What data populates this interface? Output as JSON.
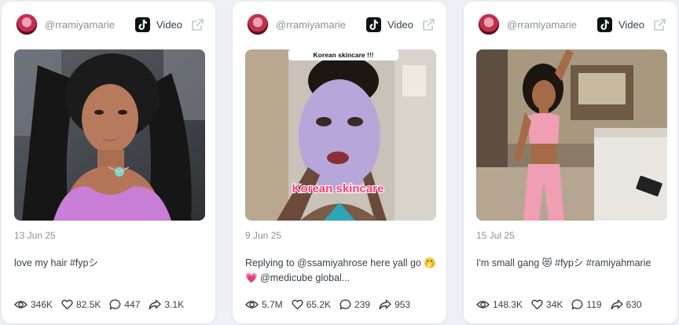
{
  "cards": [
    {
      "handle": "@rramiyamarie",
      "platform_label": "Video",
      "date": "13 Jun 25",
      "caption": "love my hair #fypシ",
      "stats": {
        "views": "346K",
        "likes": "82.5K",
        "comments": "447",
        "shares": "3.1K"
      }
    },
    {
      "handle": "@rramiyamarie",
      "platform_label": "Video",
      "date": "9 Jun 25",
      "caption": "Replying to @ssamiyahrose here yall go 🤭💗 @medicube global...",
      "thumb_banner": "Korean skincare !!!",
      "thumb_overlay": "Korean skincare",
      "stats": {
        "views": "5.7M",
        "likes": "65.2K",
        "comments": "239",
        "shares": "953"
      }
    },
    {
      "handle": "@rramiyamarie",
      "platform_label": "Video",
      "date": "15 Jul 25",
      "caption": "I'm small gang 😻 #fypシ #ramiyahmarie",
      "stats": {
        "views": "148.3K",
        "likes": "34K",
        "comments": "119",
        "shares": "630"
      }
    }
  ],
  "icons": {
    "platform": "tiktok-icon",
    "open": "external-link-icon",
    "views": "eye-icon",
    "likes": "heart-icon",
    "comments": "comment-icon",
    "shares": "share-icon"
  },
  "colors": {
    "background": "#eef0f5",
    "card": "#ffffff",
    "text": "#3b3f4d",
    "muted": "#8b8f9c",
    "overlay_text": "#ff3b73"
  }
}
